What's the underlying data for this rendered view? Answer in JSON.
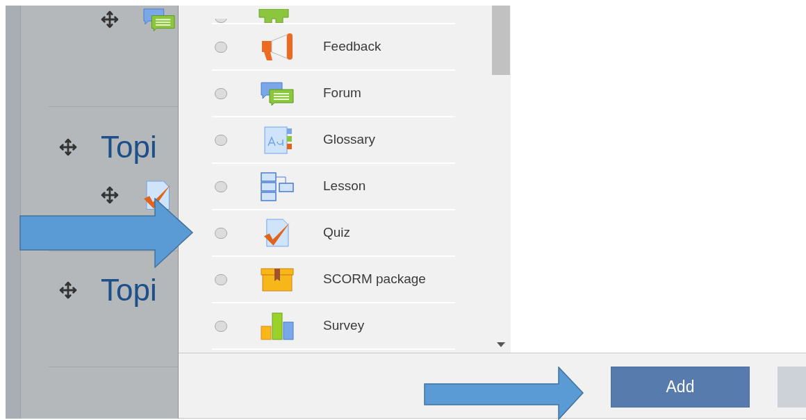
{
  "course": [
    {
      "kind": "forum"
    },
    {
      "kind": "topic",
      "title": "Topi"
    },
    {
      "kind": "quiz"
    },
    {
      "kind": "topic",
      "title": "Topi"
    }
  ],
  "modules": [
    {
      "kind": "external",
      "selected": false
    },
    {
      "kind": "feedback",
      "label": "Feedback",
      "selected": false
    },
    {
      "kind": "forum",
      "label": "Forum",
      "selected": false
    },
    {
      "kind": "glossary",
      "label": "Glossary",
      "selected": false
    },
    {
      "kind": "lesson",
      "label": "Lesson",
      "selected": false
    },
    {
      "kind": "quiz",
      "label": "Quiz",
      "selected": false
    },
    {
      "kind": "scorm",
      "label": "SCORM package",
      "selected": false
    },
    {
      "kind": "survey",
      "label": "Survey",
      "selected": false
    }
  ],
  "buttons": [
    {
      "kind": "primary",
      "label": "Add"
    },
    {
      "kind": "secondary"
    }
  ]
}
